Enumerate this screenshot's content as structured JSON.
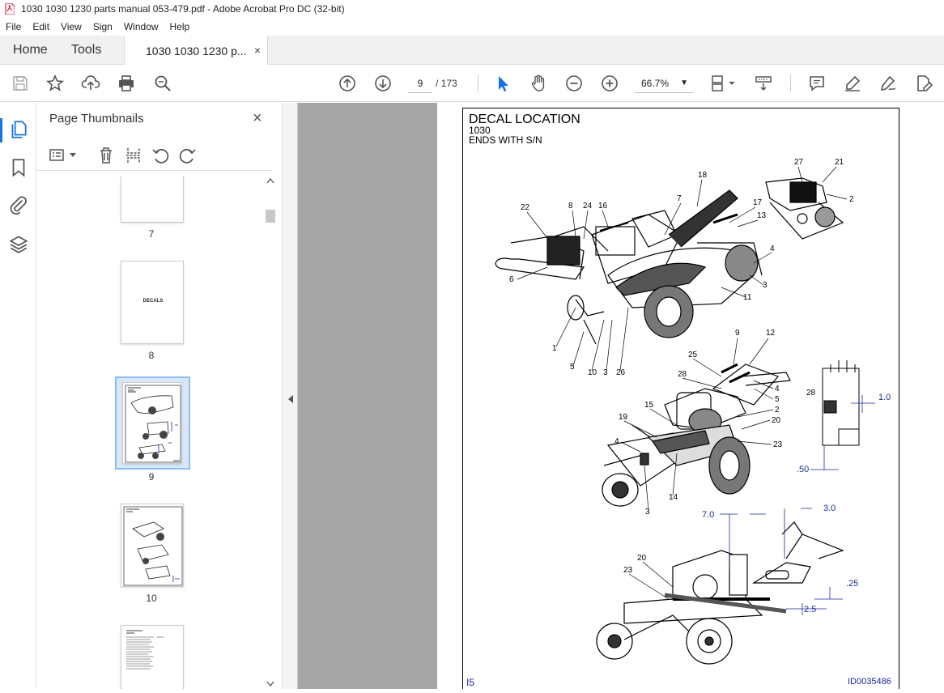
{
  "window": {
    "title": "1030 1030 1230 parts manual 053-479.pdf - Adobe Acrobat Pro DC (32-bit)"
  },
  "menu": [
    "File",
    "Edit",
    "View",
    "Sign",
    "Window",
    "Help"
  ],
  "tabs": {
    "home": "Home",
    "tools": "Tools",
    "document": "1030 1030 1230 p...",
    "close": "×"
  },
  "toolbar": {
    "current_page": "9",
    "page_total": "/ 173",
    "zoom": "66.7%"
  },
  "panel": {
    "title": "Page Thumbnails",
    "close": "×",
    "thumbnails": [
      {
        "page": "7",
        "text": ""
      },
      {
        "page": "8",
        "text": "DECALS"
      },
      {
        "page": "9",
        "text": "",
        "selected": true
      },
      {
        "page": "10",
        "text": ""
      },
      {
        "page": "",
        "text": ""
      }
    ]
  },
  "document": {
    "heading": "DECAL LOCATION",
    "model": "1030",
    "serial": "ENDS WITH S/N",
    "page_number": "I5",
    "doc_id": "ID0035486",
    "callouts_top": [
      "22",
      "8",
      "24",
      "16",
      "18",
      "7",
      "17",
      "13",
      "27",
      "21",
      "2",
      "4",
      "3",
      "11",
      "6",
      "1",
      "5",
      "10",
      "3",
      "26"
    ],
    "callouts_mid": [
      "9",
      "12",
      "25",
      "28",
      "4",
      "5",
      "2",
      "20",
      "15",
      "19",
      "4",
      "23",
      "14",
      "3",
      "28"
    ],
    "callouts_bottom": [
      "20",
      "23"
    ],
    "dimensions": [
      "1.0",
      ".50",
      "7.0",
      "3.0",
      ".25",
      "2.5"
    ]
  },
  "colors": {
    "accent": "#1473e6",
    "doc_bg": "#a6a6a6",
    "dim_blue": "#1a2a9a"
  },
  "icons": {
    "toolbar": [
      "save-icon",
      "star-icon",
      "upload-icon",
      "print-icon",
      "zoom-search-icon",
      "page-up-icon",
      "page-down-icon",
      "cursor-icon",
      "hand-icon",
      "zoom-out-icon",
      "zoom-in-icon",
      "fit-page-icon",
      "scroll-mode-icon",
      "comment-icon",
      "highlight-icon",
      "sign-icon",
      "edit-pdf-icon"
    ],
    "rail": [
      "thumbnails-icon",
      "bookmark-icon",
      "attachment-icon",
      "layers-icon"
    ]
  }
}
